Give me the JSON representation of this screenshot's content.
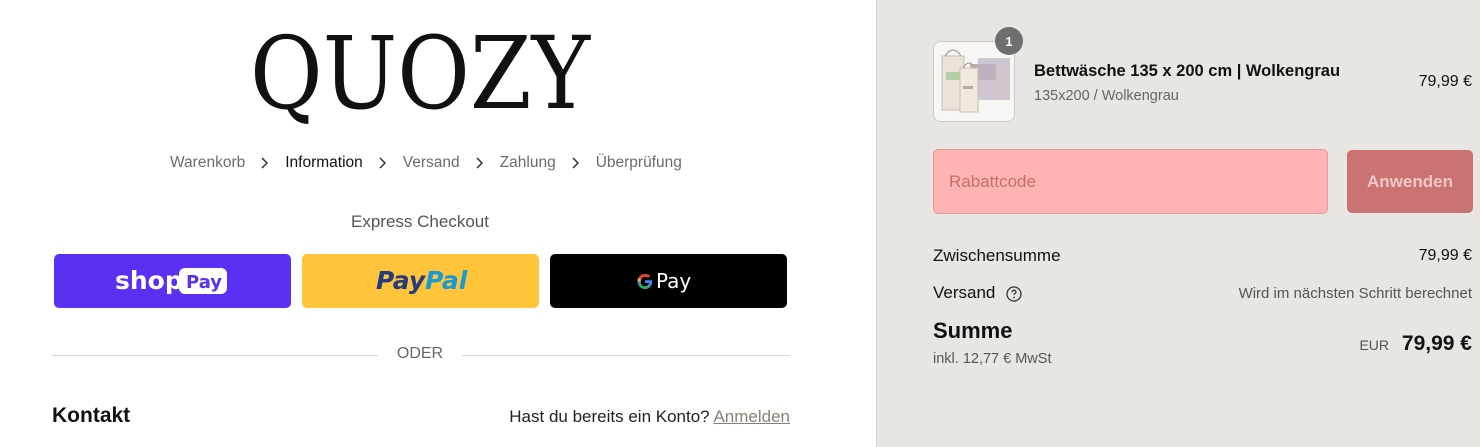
{
  "brand": {
    "logo_text": "QUOZY"
  },
  "breadcrumb": {
    "items": [
      {
        "label": "Warenkorb",
        "active": false
      },
      {
        "label": "Information",
        "active": true
      },
      {
        "label": "Versand",
        "active": false
      },
      {
        "label": "Zahlung",
        "active": false
      },
      {
        "label": "Überprüfung",
        "active": false
      }
    ],
    "separator_icon": "chevron-right-icon"
  },
  "express": {
    "title": "Express Checkout",
    "shop_pay": {
      "label_shop": "shop",
      "label_pay": "Pay",
      "color": "#5a31f4"
    },
    "paypal": {
      "label_pay": "Pay",
      "label_pal": "Pal",
      "color": "#ffc439"
    },
    "google_pay": {
      "label": "Pay",
      "color": "#000000"
    }
  },
  "divider": {
    "label": "ODER"
  },
  "contact": {
    "title": "Kontakt",
    "account_prompt": "Hast du bereits ein Konto?",
    "login_link": "Anmelden"
  },
  "cart": {
    "items": [
      {
        "name": "Bettwäsche 135 x 200 cm | Wolkengrau",
        "variant": "135x200 / Wolkengrau",
        "price": "79,99 €",
        "quantity": "1"
      }
    ]
  },
  "discount": {
    "placeholder": "Rabattcode",
    "apply_label": "Anwenden"
  },
  "summary": {
    "subtotal_label": "Zwischensumme",
    "subtotal_value": "79,99 €",
    "shipping_label": "Versand",
    "shipping_value": "Wird im nächsten Schritt berechnet",
    "total_label": "Summe",
    "tax_note": "inkl. 12,77 € MwSt",
    "currency": "EUR",
    "total_value": "79,99 €"
  }
}
